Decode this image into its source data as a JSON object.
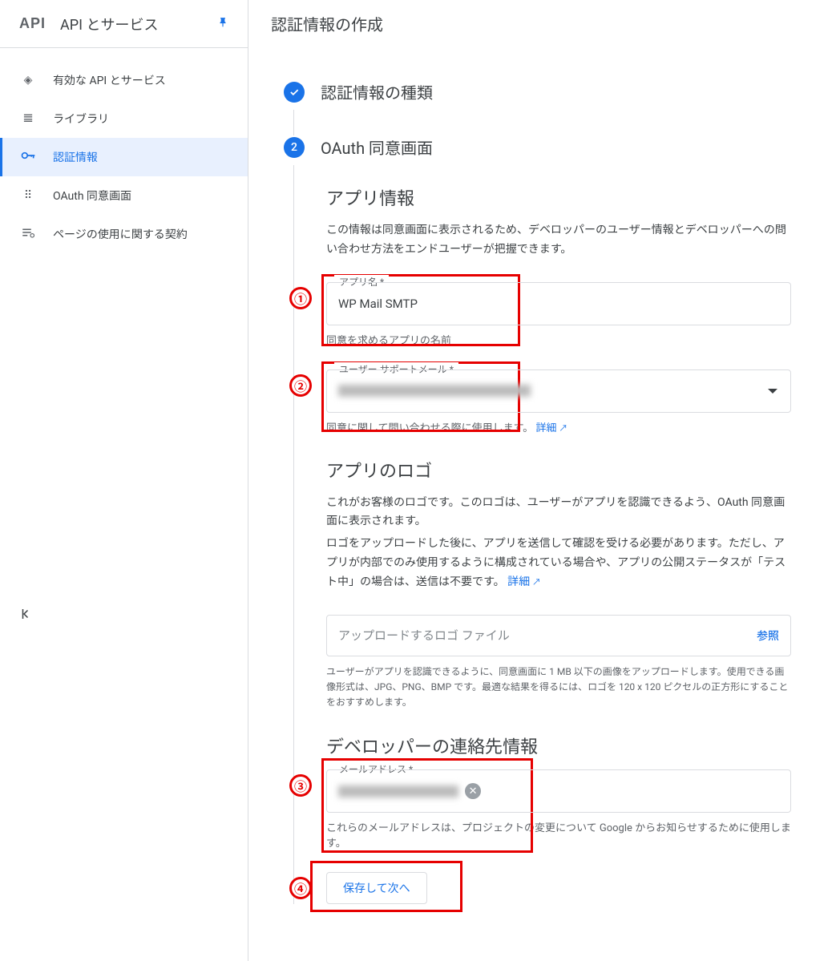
{
  "header": {
    "logo_text": "API",
    "product_title": "API とサービス"
  },
  "sidebar": {
    "items": [
      {
        "label": "有効な API とサービス",
        "icon": "◈"
      },
      {
        "label": "ライブラリ",
        "icon": "𝌆"
      },
      {
        "label": "認証情報",
        "icon": "⚿"
      },
      {
        "label": "OAuth 同意画面",
        "icon": "⠿"
      },
      {
        "label": "ページの使用に関する契約",
        "icon": "≡"
      }
    ]
  },
  "main": {
    "page_title": "認証情報の作成",
    "step1": {
      "title": "認証情報の種類",
      "badge": "✓"
    },
    "step2": {
      "badge": "2",
      "title": "OAuth 同意画面",
      "app_info": {
        "heading": "アプリ情報",
        "description": "この情報は同意画面に表示されるため、デベロッパーのユーザー情報とデベロッパーへの問い合わせ方法をエンドユーザーが把握できます。",
        "app_name_label": "アプリ名 *",
        "app_name_value": "WP Mail SMTP",
        "app_name_helper": "同意を求めるアプリの名前",
        "support_email_label": "ユーザー サポートメール *",
        "support_email_value": "████████████████",
        "support_email_helper": "同意に関して問い合わせる際に使用します。",
        "details_link": "詳細"
      },
      "app_logo": {
        "heading": "アプリのロゴ",
        "desc1": "これがお客様のロゴです。このロゴは、ユーザーがアプリを認識できるよう、OAuth 同意画面に表示されます。",
        "desc2": "ロゴをアップロードした後に、アプリを送信して確認を受ける必要があります。ただし、アプリが内部でのみ使用するように構成されている場合や、アプリの公開ステータスが「テスト中」の場合は、送信は不要です。",
        "details_link": "詳細",
        "upload_placeholder": "アップロードするロゴ ファイル",
        "browse": "参照",
        "upload_helper": "ユーザーがアプリを認識できるように、同意画面に 1 MB 以下の画像をアップロードします。使用できる画像形式は、JPG、PNG、BMP です。最適な結果を得るには、ロゴを 120 x 120 ピクセルの正方形にすることをおすすめします。"
      },
      "dev_contact": {
        "heading": "デベロッパーの連絡先情報",
        "email_label": "メールアドレス *",
        "email_value": "██████████",
        "helper": "これらのメールアドレスは、プロジェクトの変更について Google からお知らせするために使用します。"
      },
      "save_label": "保存して次へ"
    }
  },
  "annotations": {
    "n1": "①",
    "n2": "②",
    "n3": "③",
    "n4": "④"
  }
}
